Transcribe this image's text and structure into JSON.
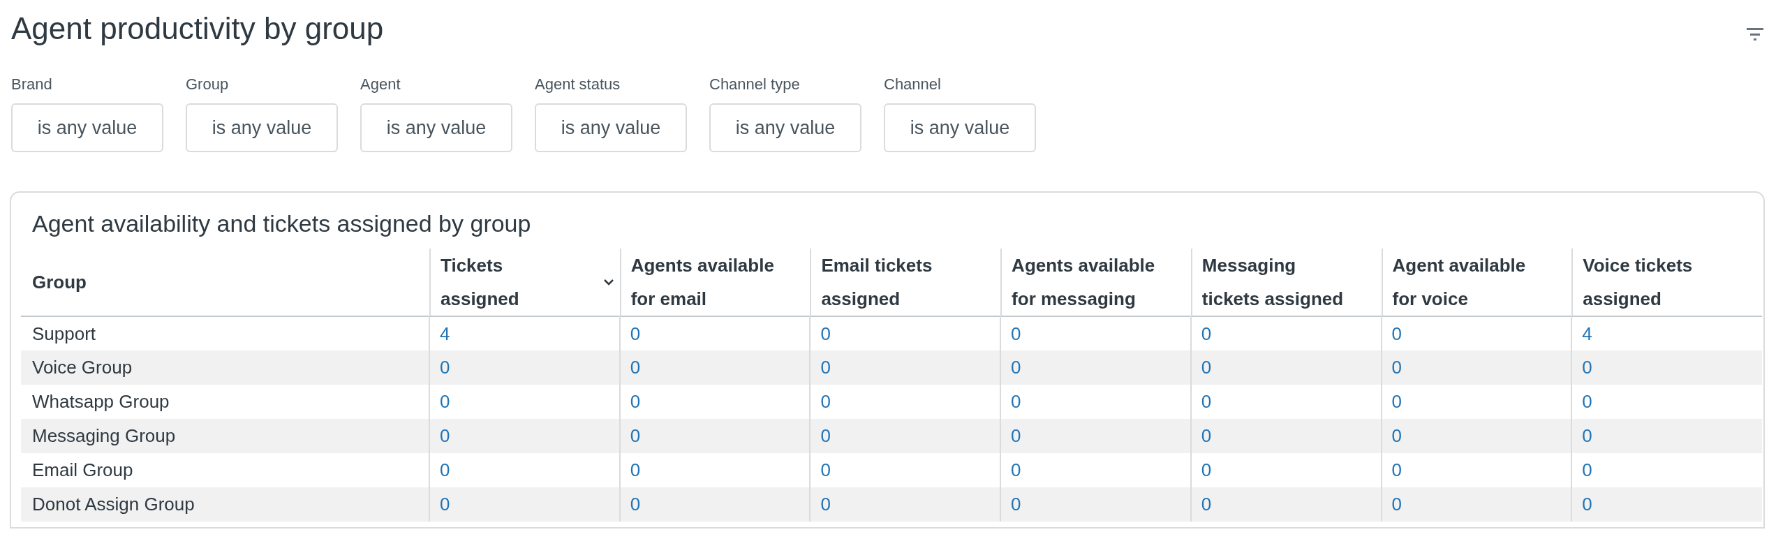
{
  "title": "Agent productivity by group",
  "filters": [
    {
      "label": "Brand",
      "value": "is any value"
    },
    {
      "label": "Group",
      "value": "is any value"
    },
    {
      "label": "Agent",
      "value": "is any value"
    },
    {
      "label": "Agent status",
      "value": "is any value"
    },
    {
      "label": "Channel type",
      "value": "is any value"
    },
    {
      "label": "Channel",
      "value": "is any value"
    }
  ],
  "table": {
    "title": "Agent availability and tickets assigned by group",
    "columns": [
      {
        "label": "Group",
        "sorted": false
      },
      {
        "label": "Tickets assigned",
        "sorted": true
      },
      {
        "label": "Agents available for email",
        "sorted": false
      },
      {
        "label": "Email tickets assigned",
        "sorted": false
      },
      {
        "label": "Agents available for messaging",
        "sorted": false
      },
      {
        "label": "Messaging tickets assigned",
        "sorted": false
      },
      {
        "label": "Agent available for voice",
        "sorted": false
      },
      {
        "label": "Voice tickets assigned",
        "sorted": false
      }
    ],
    "rows": [
      [
        "Support",
        "4",
        "0",
        "0",
        "0",
        "0",
        "0",
        "4"
      ],
      [
        "Voice Group",
        "0",
        "0",
        "0",
        "0",
        "0",
        "0",
        "0"
      ],
      [
        "Whatsapp Group",
        "0",
        "0",
        "0",
        "0",
        "0",
        "0",
        "0"
      ],
      [
        "Messaging Group",
        "0",
        "0",
        "0",
        "0",
        "0",
        "0",
        "0"
      ],
      [
        "Email Group",
        "0",
        "0",
        "0",
        "0",
        "0",
        "0",
        "0"
      ],
      [
        "Donot Assign Group",
        "0",
        "0",
        "0",
        "0",
        "0",
        "0",
        "0"
      ]
    ]
  }
}
